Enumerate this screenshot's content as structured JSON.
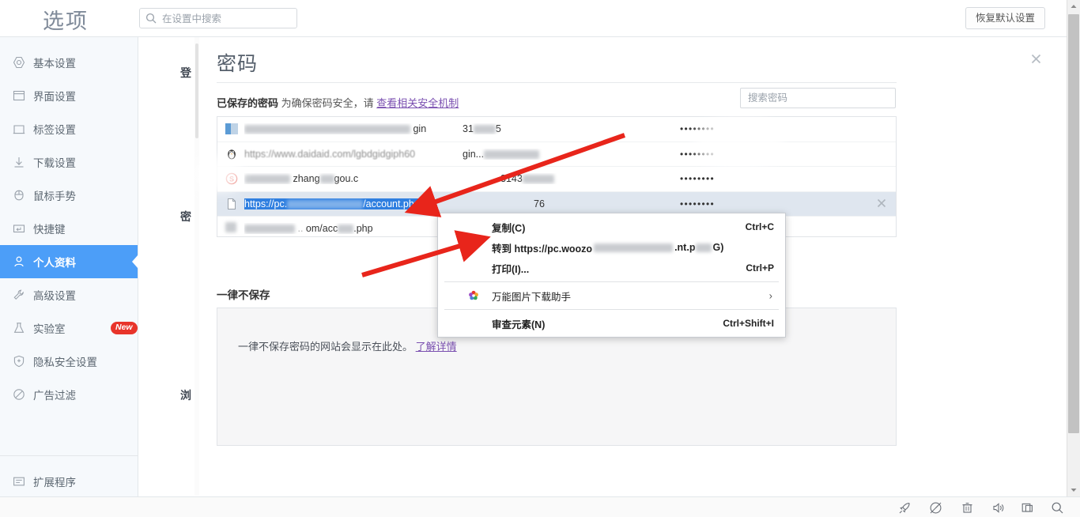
{
  "header": {
    "app_title": "选项",
    "search_placeholder": "在设置中搜索",
    "search_value": "",
    "search_icon": "search-icon",
    "reset_button": "恢复默认设置"
  },
  "sidebar": {
    "items": [
      {
        "label": "基本设置",
        "icon": "gear-circle-icon",
        "active": false
      },
      {
        "label": "界面设置",
        "icon": "window-icon",
        "active": false
      },
      {
        "label": "标签设置",
        "icon": "tab-icon",
        "active": false
      },
      {
        "label": "下载设置",
        "icon": "download-icon",
        "active": false
      },
      {
        "label": "鼠标手势",
        "icon": "mouse-icon",
        "active": false
      },
      {
        "label": "快捷键",
        "icon": "keyboard-key-icon",
        "active": false
      },
      {
        "label": "个人资料",
        "icon": "user-icon",
        "active": true
      },
      {
        "label": "高级设置",
        "icon": "wrench-icon",
        "active": false
      },
      {
        "label": "实验室",
        "icon": "flask-icon",
        "active": false,
        "badge": "New"
      },
      {
        "label": "隐私安全设置",
        "icon": "shield-plus-icon",
        "active": false
      },
      {
        "label": "广告过滤",
        "icon": "block-icon",
        "active": false
      }
    ],
    "bottom_items": [
      {
        "label": "扩展程序",
        "icon": "extension-icon"
      }
    ]
  },
  "background_page": {
    "ghost_labels": [
      "登",
      "密",
      "浏"
    ]
  },
  "modal": {
    "title": "密码",
    "close_icon": "close-icon",
    "saved_section": {
      "heading_bold": "已保存的密码",
      "heading_rest": "为确保密码安全，请",
      "link": "查看相关安全机制"
    },
    "password_search_placeholder": "搜索密码",
    "password_search_value": "",
    "rows": [
      {
        "icon": "blue-square-favicon",
        "site": "",
        "site_suffix": "gin",
        "user": "31",
        "user_suffix": "5",
        "password": "••••••••",
        "selected": false,
        "redacted": true
      },
      {
        "icon": "qq-penguin-favicon",
        "site": "https://www.daidaid.com/lgbdgidgiph60",
        "site_suffix": "",
        "user": "gin...",
        "user_suffix": "",
        "password": "••••••••",
        "selected": false,
        "redacted": true
      },
      {
        "icon": "sogou-s-favicon",
        "site": "zhang",
        "site_suffix": "gou.c",
        "user": "3143",
        "user_suffix": "",
        "password": "••••••••",
        "selected": false,
        "redacted": true
      },
      {
        "icon": "document-favicon",
        "site": "https://pc.",
        "site_suffix": "/account.php",
        "user": "76",
        "user_suffix": "",
        "password": "••••••••",
        "selected": true,
        "redacted": true
      },
      {
        "icon": "blank-favicon",
        "site": "om/acc",
        "site_suffix": ".php",
        "user": "",
        "user_suffix": "",
        "password": "",
        "selected": false,
        "redacted": true
      }
    ],
    "never_section": {
      "title": "一律不保存",
      "text": "一律不保存密码的网站会显示在此处。",
      "link": "了解详情"
    }
  },
  "context_menu": {
    "items": [
      {
        "label": "复制(C)",
        "mnemonic": "C",
        "accel": "Ctrl+C",
        "icon": "",
        "submenu": false
      },
      {
        "label": "转到 https://pc.woozo",
        "label_tail": ".nt.p",
        "mnemonic": "G",
        "accel": "",
        "icon": "",
        "submenu": false
      },
      {
        "label": "打印(I)...",
        "mnemonic": "I",
        "accel": "Ctrl+P",
        "icon": "",
        "submenu": false
      },
      {
        "label": "万能图片下载助手",
        "mnemonic": "",
        "accel": "",
        "icon": "flower-color-icon",
        "submenu": true
      },
      {
        "label": "审查元素(N)",
        "mnemonic": "N",
        "accel": "Ctrl+Shift+I",
        "icon": "",
        "submenu": false
      }
    ]
  },
  "bottom_bar": {
    "icons": [
      "rocket-icon",
      "speedometer-icon",
      "trash-icon",
      "speaker-icon",
      "split-window-icon",
      "search-icon"
    ]
  },
  "colors": {
    "accent": "#4c9ef8",
    "badge_red": "#e8342a",
    "link_purple": "#7a4fb0",
    "selection_blue": "#2f7fe0",
    "row_selected": "#dfe6ef",
    "arrow_red": "#e8251b"
  }
}
